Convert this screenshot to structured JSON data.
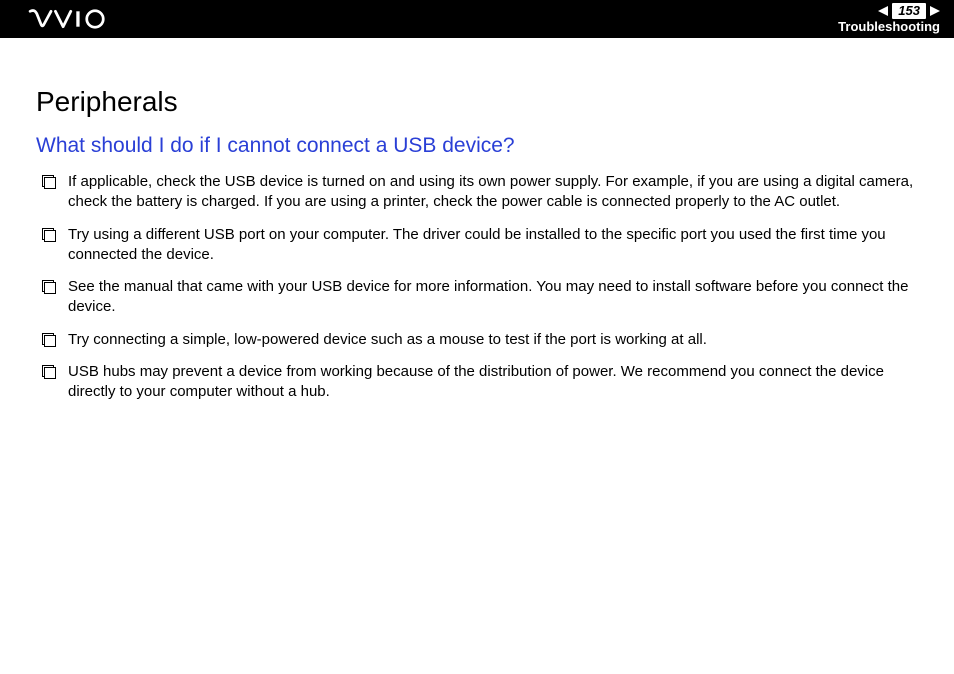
{
  "header": {
    "page_number": "153",
    "section": "Troubleshooting"
  },
  "content": {
    "title": "Peripherals",
    "question": "What should I do if I cannot connect a USB device?",
    "items": [
      "If applicable, check the USB device is turned on and using its own power supply. For example, if you are using a digital camera, check the battery is charged. If you are using a printer, check the power cable is connected properly to the AC outlet.",
      "Try using a different USB port on your computer. The driver could be installed to the specific port you used the first time you connected the device.",
      "See the manual that came with your USB device for more information. You may need to install software before you connect the device.",
      "Try connecting a simple, low-powered device such as a mouse to test if the port is working at all.",
      "USB hubs may prevent a device from working because of the distribution of power. We recommend you connect the device directly to your computer without a hub."
    ]
  }
}
